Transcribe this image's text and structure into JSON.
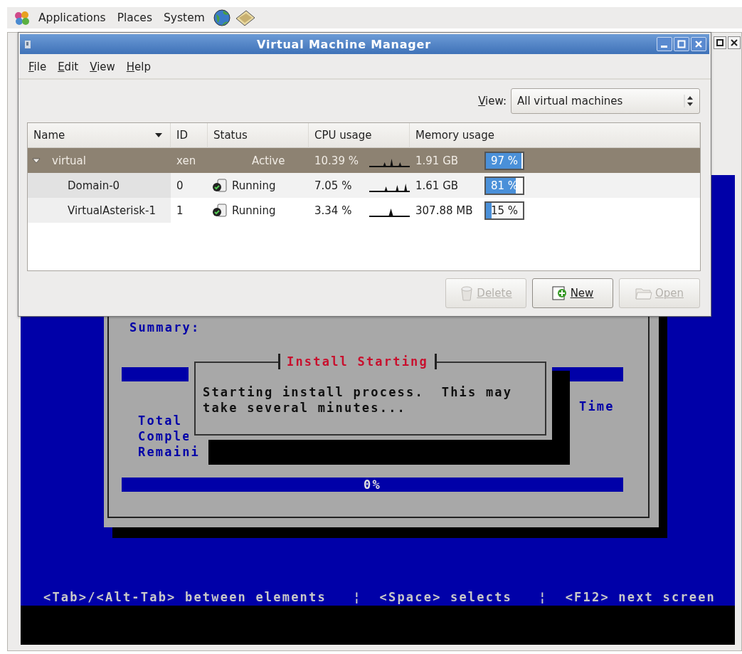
{
  "top_panel": {
    "menus": [
      {
        "label": "Applications"
      },
      {
        "label": "Places"
      },
      {
        "label": "System"
      }
    ]
  },
  "console_window": {
    "dialog": {
      "summary": "Summary:",
      "labels_left": [
        "Total",
        "Comple",
        "Remaini"
      ],
      "label_right": "Time",
      "progress": {
        "label": "0%",
        "level": 0
      }
    },
    "popup": {
      "title": "Install Starting",
      "lines": [
        "Starting install process.  This may",
        "take several minutes..."
      ]
    },
    "footer": "<Tab>/<Alt-Tab> between elements   ¦  <Space> selects   ¦  <F12> next screen"
  },
  "vmm_window": {
    "title": "Virtual Machine Manager",
    "menu": [
      {
        "label": "File"
      },
      {
        "label": "Edit"
      },
      {
        "label": "View"
      },
      {
        "label": "Help"
      }
    ],
    "view_filter": {
      "label": "View:",
      "value": "All virtual machines"
    },
    "table": {
      "columns": [
        "Name",
        "ID",
        "Status",
        "CPU usage",
        "Memory usage"
      ],
      "rows": [
        {
          "name": "virtual",
          "id": "xen",
          "status": "Active",
          "cpu": "10.39 %",
          "memory": "1.91 GB",
          "level": 0.97,
          "memory_percent": "97 %",
          "selected": true,
          "expanded": true,
          "children": [
            {
              "name": "Domain-0",
              "id": "0",
              "status": "Running",
              "cpu": "7.05 %",
              "memory": "1.61 GB",
              "level": 0.81,
              "memory_percent": "81 %",
              "selected": false
            },
            {
              "name": "VirtualAsterisk-1",
              "id": "1",
              "status": "Running",
              "cpu": "3.34 %",
              "memory": "307.88 MB",
              "level": 0.15,
              "memory_percent": "15 %",
              "selected": false
            }
          ]
        }
      ]
    },
    "buttons": [
      {
        "kind": "delete",
        "label": "Delete",
        "disabled": true
      },
      {
        "kind": "new",
        "label": "New",
        "disabled": false
      },
      {
        "kind": "open",
        "label": "Open",
        "disabled": true
      }
    ]
  }
}
